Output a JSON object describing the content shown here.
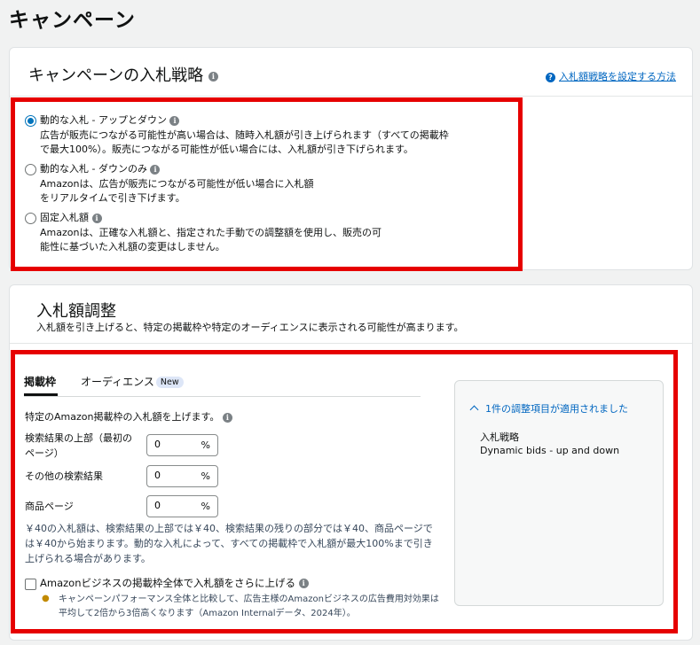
{
  "page_title": "キャンペーン",
  "strategy_card": {
    "title": "キャンペーンの入札戦略",
    "help_link": "入札額戦略を設定する方法",
    "options": [
      {
        "label": "動的な入札 - アップとダウン",
        "desc_lines": [
          "広告が販売につながる可能性が高い場合は、随時入札額が引き上げられます（すべての掲載枠",
          "で最大100%）。販売につながる可能性が低い場合には、入札額が引き下げられます。"
        ],
        "selected": true
      },
      {
        "label": "動的な入札 - ダウンのみ",
        "desc_lines": [
          "Amazonは、広告が販売につながる可能性が低い場合に入札額",
          "をリアルタイムで引き下げます。"
        ],
        "selected": false
      },
      {
        "label": "固定入札額",
        "desc_lines": [
          "Amazonは、正確な入札額と、指定された手動での調整額を使用し、販売の可",
          "能性に基づいた入札額の変更はしません。"
        ],
        "selected": false
      }
    ]
  },
  "adjust_card": {
    "title": "入札額調整",
    "subtitle": "入札額を引き上げると、特定の掲載枠や特定のオーディエンスに表示される可能性が高まります。",
    "tabs": [
      {
        "label": "掲載枠",
        "active": true
      },
      {
        "label": "オーディエンス",
        "badge": "New",
        "active": false
      }
    ],
    "placement_heading": "特定のAmazon掲載枠の入札額を上げます。",
    "fields": [
      {
        "label_lines": [
          "検索結果の上部（最初の",
          "ページ）"
        ],
        "value": "0",
        "unit": "%"
      },
      {
        "label_lines": [
          "その他の検索結果"
        ],
        "value": "0",
        "unit": "%"
      },
      {
        "label_lines": [
          "商品ページ"
        ],
        "value": "0",
        "unit": "%"
      }
    ],
    "note": "￥40の入札額は、検索結果の上部では￥40、検索結果の残りの部分では￥40、商品ページでは￥40から始まります。動的な入札によって、すべての掲載枠で入札額が最大100%まで引き上げられる場合があります。",
    "checkbox_label": "Amazonビジネスの掲載枠全体で入札額をさらに上げる",
    "tip": "キャンペーンパフォーマンス全体と比較して、広告主様のAmazonビジネスの広告費用対効果は平均して2倍から3倍高くなります（Amazon Internalデータ、2024年）。",
    "summary": {
      "toggle": "1件の調整項目が適用されました",
      "label": "入札戦略",
      "value": "Dynamic bids - up and down"
    }
  },
  "colors": {
    "highlight": "#e60000",
    "link": "#0066c0",
    "radio": "#0073bb"
  }
}
